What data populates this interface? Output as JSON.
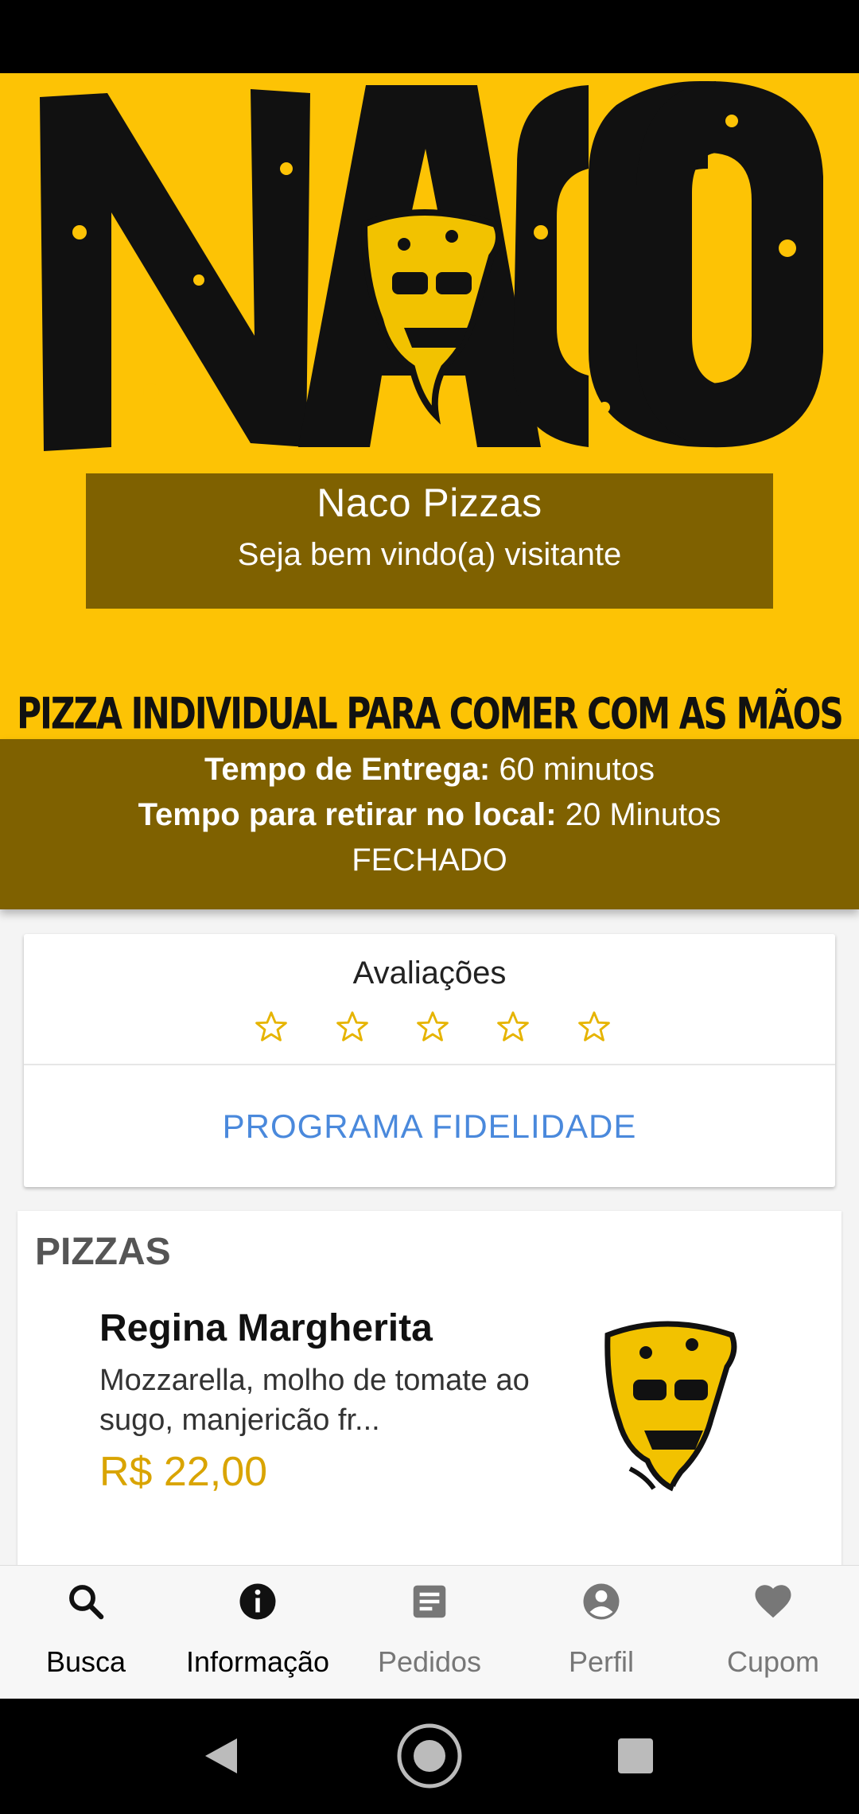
{
  "hero": {
    "logo_text": "NACO",
    "store_name": "Naco Pizzas",
    "welcome": "Seja bem vindo(a) visitante",
    "tagline": "PIZZA INDIVIDUAL PARA COMER COM AS MÃOS",
    "background_color": "#fdc305",
    "overlay_color": "#7f6100"
  },
  "delivery": {
    "delivery_label": "Tempo de Entrega:",
    "delivery_value": "60 minutos",
    "pickup_label": "Tempo para retirar no local:",
    "pickup_value": "20 Minutos",
    "status": "FECHADO"
  },
  "rating": {
    "title": "Avaliações",
    "stars_filled": 0,
    "stars_total": 5,
    "star_color": "#e6b400"
  },
  "fidelity": {
    "label": "PROGRAMA FIDELIDADE",
    "color": "#4a89dc"
  },
  "menu": {
    "category": "PIZZAS",
    "items": [
      {
        "name": "Regina Margherita",
        "description": "Mozzarella, molho de tomate ao sugo, manjericão fr...",
        "price": "R$ 22,00",
        "image_icon": "pizza-skull-logo-icon"
      }
    ]
  },
  "bottom_nav": {
    "items": [
      {
        "label": "Busca",
        "icon": "search-icon"
      },
      {
        "label": "Informação",
        "icon": "info-icon"
      },
      {
        "label": "Pedidos",
        "icon": "orders-icon"
      },
      {
        "label": "Perfil",
        "icon": "profile-icon"
      },
      {
        "label": "Cupom",
        "icon": "heart-icon"
      }
    ]
  },
  "system_nav": {
    "items": [
      "back-icon",
      "home-icon",
      "recents-icon"
    ]
  }
}
